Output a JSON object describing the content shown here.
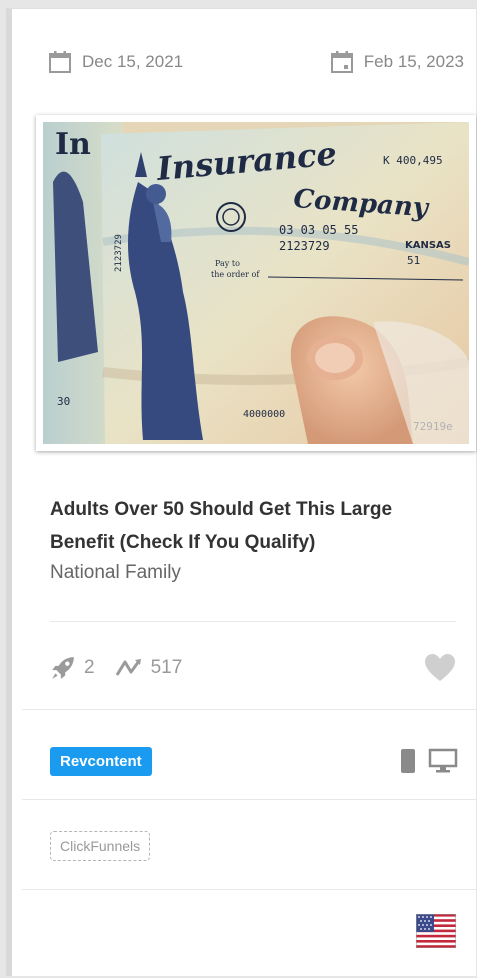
{
  "dates": {
    "first_seen": "Dec 15, 2021",
    "last_seen": "Feb 15, 2023"
  },
  "ad": {
    "title": "Adults Over 50 Should Get This Large Benefit (Check If You Qualify)",
    "source": "National Family",
    "image_alt": "Insurance Company check with Statue of Liberty held by hand",
    "image_text": {
      "brand": "Insurance Company",
      "numbers_top": "K 400,495",
      "date_line": "03 03 05  55",
      "account": "2123729",
      "region": "KANSAS",
      "code": "51",
      "pay_to": "Pay to the order of",
      "bottom_left": "30",
      "bottom_mid": "4000000",
      "bottom_right": "72919e",
      "left_vertical": "2123729"
    }
  },
  "stats": {
    "rocket_count": "2",
    "trend_count": "517"
  },
  "network": {
    "label": "Revcontent",
    "color": "#1a9bef"
  },
  "devices": [
    "mobile-icon",
    "desktop-icon"
  ],
  "tech": {
    "label": "ClickFunnels"
  },
  "country": {
    "flag": "us-flag-icon"
  }
}
